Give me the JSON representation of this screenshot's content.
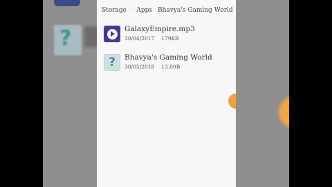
{
  "breadcrumb": {
    "items": [
      "Storage",
      "Apps",
      "Bhavya's Gaming World"
    ],
    "separator": "›"
  },
  "files": [
    {
      "name": "GalaxyEmpire.mp3",
      "date": "30/04/2017",
      "size": "179KB",
      "icon": "music-file-icon"
    },
    {
      "name": "Bhavya's Gaming World",
      "date": "30/05/2018",
      "size": "13.00B",
      "icon": "unknown-file-icon"
    }
  ],
  "colors": {
    "music_icon_bg": "#3f3b9a",
    "unknown_icon_bg": "#d2dee1",
    "accent_orange": "#f2a03c"
  }
}
